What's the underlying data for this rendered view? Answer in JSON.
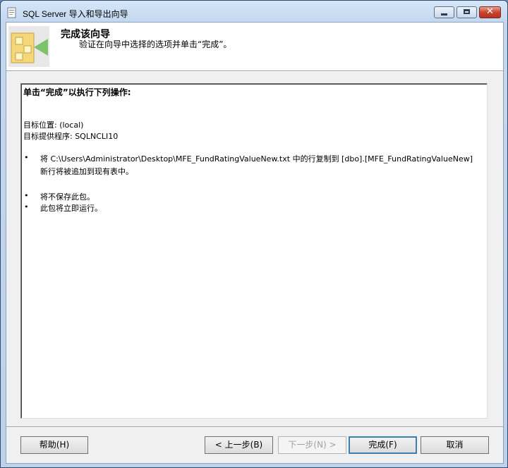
{
  "window": {
    "title": "SQL Server 导入和导出向导",
    "caption_buttons": {
      "minimize": "minimize",
      "maximize": "maximize",
      "close": "✕"
    }
  },
  "header": {
    "title": "完成该向导",
    "subtitle": "验证在向导中选择的选项并单击“完成”。",
    "icon": "wizard-finish-icon"
  },
  "summary": {
    "heading": "单击“完成”以执行下列操作:",
    "destination_line": "目标位置: (local)",
    "provider_line": "目标提供程序: SQLNCLI10",
    "bullet_glyph": "•",
    "bullets": [
      {
        "line1": "将 C:\\Users\\Administrator\\Desktop\\MFE_FundRatingValueNew.txt 中的行复制到 [dbo].[MFE_FundRatingValueNew]",
        "line2": "新行将被追加到现有表中。"
      },
      {
        "line1": "将不保存此包。"
      },
      {
        "line1": "此包将立即运行。"
      }
    ]
  },
  "buttons": {
    "help": "帮助(H)",
    "back": "< 上一步(B)",
    "next": "下一步(N) >",
    "finish": "完成(F)",
    "cancel": "取消"
  },
  "colors": {
    "frame": "#c3d8ef",
    "client_bg": "#f0f0f0",
    "default_button_border": "#3c7fb1"
  }
}
